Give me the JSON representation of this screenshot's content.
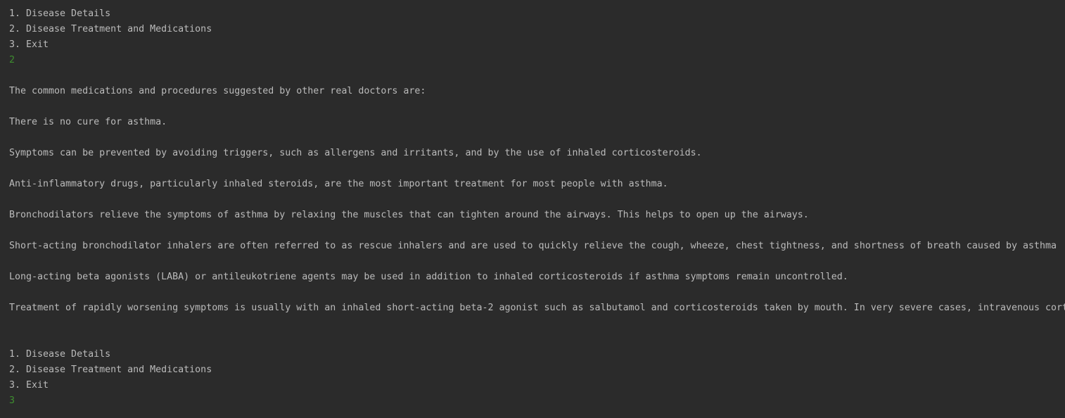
{
  "console": {
    "menu_first": {
      "item1": "1. Disease Details",
      "item2": "2. Disease Treatment and Medications",
      "item3": "3. Exit",
      "user_input": "2"
    },
    "output": {
      "intro": "The common medications and procedures suggested by other real doctors are:",
      "line1": "There is no cure for asthma.",
      "line2": "Symptoms can be prevented by avoiding triggers, such as allergens and irritants, and by the use of inhaled corticosteroids.",
      "line3": "Anti-inflammatory drugs, particularly inhaled steroids, are the most important treatment for most people with asthma.",
      "line4": "Bronchodilators relieve the symptoms of asthma by relaxing the muscles that can tighten around the airways. This helps to open up the airways.",
      "line5": "Short-acting bronchodilator inhalers are often referred to as rescue inhalers and are used to quickly relieve the cough, wheeze, chest tightness, and shortness of breath caused by asthma",
      "line6": "Long-acting beta agonists (LABA) or antileukotriene agents may be used in addition to inhaled corticosteroids if asthma symptoms remain uncontrolled.",
      "line7": "Treatment of rapidly worsening symptoms is usually with an inhaled short-acting beta-2 agonist such as salbutamol and corticosteroids taken by mouth. In very severe cases, intravenous cort"
    },
    "menu_second": {
      "item1": "1. Disease Details",
      "item2": "2. Disease Treatment and Medications",
      "item3": "3. Exit",
      "user_input": "3"
    }
  },
  "colors": {
    "background": "#2b2b2b",
    "text": "#bbbbbb",
    "user_input": "#3e8e2f"
  }
}
